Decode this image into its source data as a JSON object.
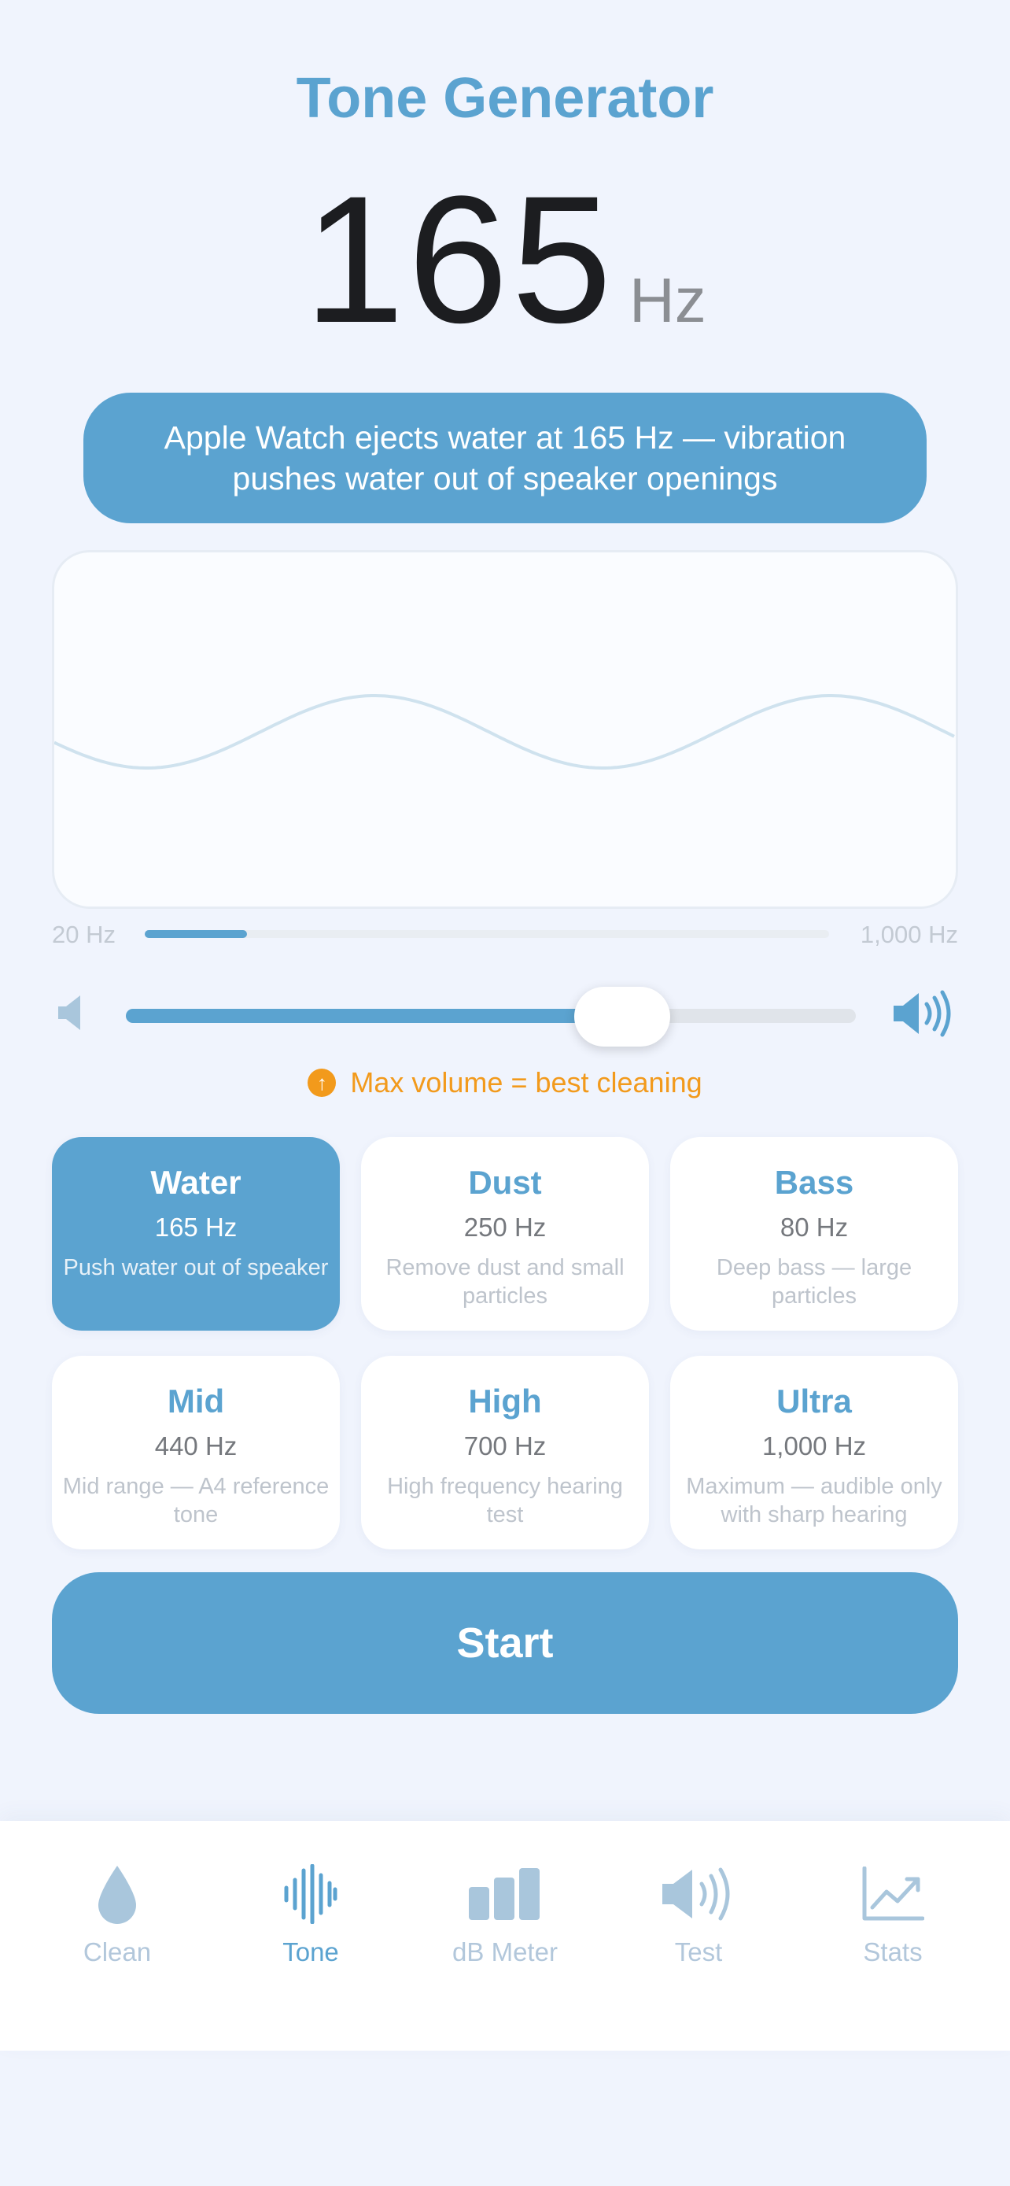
{
  "title": "Tone Generator",
  "frequency": {
    "value": "165",
    "unit": "Hz"
  },
  "info_text": "Apple Watch ejects water at 165 Hz — vibration pushes water out of speaker openings",
  "range": {
    "min_label": "20 Hz",
    "max_label": "1,000 Hz",
    "fraction": 0.149
  },
  "volume": {
    "level": 0.68
  },
  "hint": "Max volume = best cleaning",
  "presets": [
    {
      "name": "Water",
      "hz": "165 Hz",
      "desc": "Push water out of speaker",
      "selected": true
    },
    {
      "name": "Dust",
      "hz": "250 Hz",
      "desc": "Remove dust and small particles",
      "selected": false
    },
    {
      "name": "Bass",
      "hz": "80 Hz",
      "desc": "Deep bass — large particles",
      "selected": false
    },
    {
      "name": "Mid",
      "hz": "440 Hz",
      "desc": "Mid range — A4 reference tone",
      "selected": false
    },
    {
      "name": "High",
      "hz": "700 Hz",
      "desc": "High frequency hearing test",
      "selected": false
    },
    {
      "name": "Ultra",
      "hz": "1,000 Hz",
      "desc": "Maximum — audible only with sharp hearing",
      "selected": false
    }
  ],
  "start_label": "Start",
  "tabs": [
    {
      "label": "Clean",
      "icon": "droplet-icon",
      "active": false
    },
    {
      "label": "Tone",
      "icon": "waveform-icon",
      "active": true
    },
    {
      "label": "dB Meter",
      "icon": "bars-icon",
      "active": false
    },
    {
      "label": "Test",
      "icon": "speaker-wave-icon",
      "active": false
    },
    {
      "label": "Stats",
      "icon": "chart-line-icon",
      "active": false
    }
  ],
  "colors": {
    "accent": "#5ba3d0",
    "warning": "#f29a1c",
    "background": "#f0f4fd"
  }
}
